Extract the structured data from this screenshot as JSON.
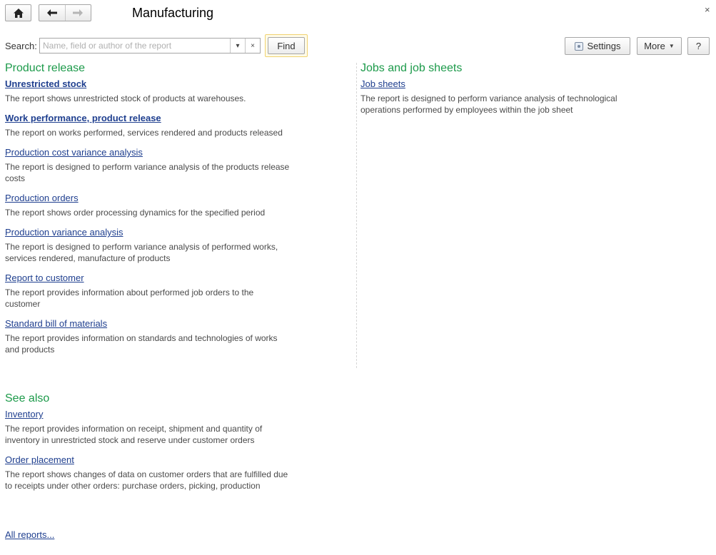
{
  "window": {
    "title": "Manufacturing",
    "close_label": "×"
  },
  "toolbar": {
    "search_label": "Search:",
    "search_placeholder": "Name, field or author of the report",
    "search_value": "",
    "clear_label": "×",
    "dropdown_label": "▾",
    "find_label": "Find",
    "settings_label": "Settings",
    "more_label": "More",
    "help_label": "?"
  },
  "sections": {
    "product_release": {
      "title": "Product release",
      "reports": [
        {
          "label": "Unrestricted stock",
          "description": "The report shows unrestricted stock of products at warehouses."
        },
        {
          "label": "Work performance, product release",
          "description": "The report on works performed, services rendered and products released"
        },
        {
          "label": "Production cost variance analysis",
          "description": "The report is designed to perform variance analysis of the products release costs"
        },
        {
          "label": "Production orders",
          "description": "The report shows order processing dynamics for the specified period"
        },
        {
          "label": "Production variance analysis",
          "description": "The report is designed to perform variance analysis of performed works, services rendered, manufacture of products"
        },
        {
          "label": "Report to customer",
          "description": "The report provides information about performed job orders to the customer"
        },
        {
          "label": "Standard bill of materials",
          "description": "The report provides information on standards and technologies of works and products"
        }
      ]
    },
    "jobs": {
      "title": "Jobs and job sheets",
      "reports": [
        {
          "label": "Job sheets",
          "description": "The report is designed to perform variance analysis of technological operations performed by employees within the job sheet"
        }
      ]
    },
    "see_also": {
      "title": "See also",
      "reports": [
        {
          "label": "Inventory",
          "description": "The report provides information on receipt, shipment and quantity of inventory in unrestricted stock and reserve under customer orders"
        },
        {
          "label": "Order placement",
          "description": "The report shows changes of data on customer orders that are fulfilled due to receipts under other orders: purchase orders, picking, production"
        }
      ]
    }
  },
  "footer": {
    "all_reports_label": "All reports..."
  },
  "colors": {
    "section_title": "#1c9a4a",
    "link": "#1f3f8f",
    "find_highlight": "#f0d270"
  }
}
